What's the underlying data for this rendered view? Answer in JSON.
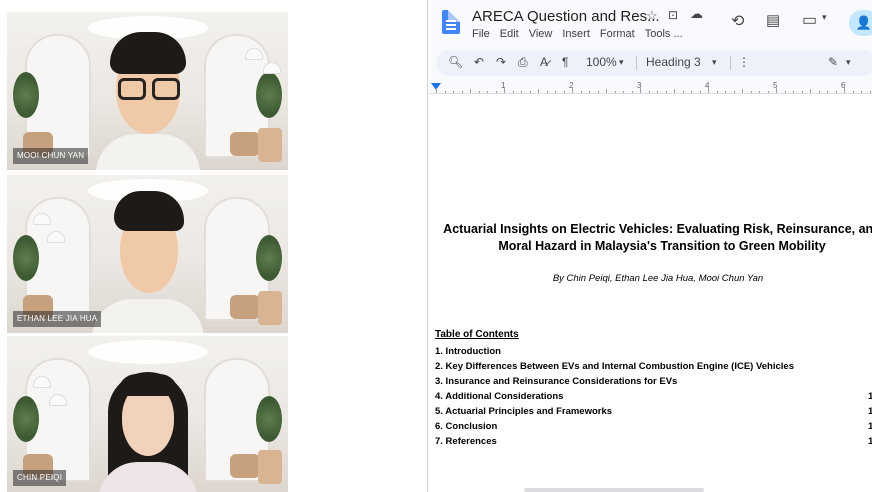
{
  "participants": [
    {
      "name": "MOOI CHUN YAN"
    },
    {
      "name": "ETHAN LEE JIA HUA"
    },
    {
      "name": "CHIN PEIQI"
    }
  ],
  "doc": {
    "title": "ARECA Question and Res...",
    "menu": [
      "File",
      "Edit",
      "View",
      "Insert",
      "Format",
      "Tools ..."
    ],
    "toolbar": {
      "zoom": "100%",
      "style": "Heading 3"
    },
    "ruler_numbers": [
      "1",
      "2",
      "3",
      "4",
      "5",
      "6"
    ],
    "heading_line1": "Actuarial Insights on Electric Vehicles: Evaluating Risk, Reinsurance, and",
    "heading_line2": "Moral Hazard in Malaysia's Transition to Green Mobility",
    "authors": "By Chin Peiqi, Ethan Lee Jia Hua, Mooi Chun Yan",
    "toc_heading": "Table of Contents",
    "toc": [
      {
        "label": "1. Introduction",
        "page": ""
      },
      {
        "label": "2. Key Differences Between EVs and Internal Combustion Engine (ICE) Vehicles",
        "page": ""
      },
      {
        "label": "3. Insurance and Reinsurance Considerations for EVs",
        "page": ""
      },
      {
        "label": "4. Additional Considerations",
        "page": "1"
      },
      {
        "label": "5. Actuarial Principles and Frameworks",
        "page": "1"
      },
      {
        "label": "6. Conclusion",
        "page": "1"
      },
      {
        "label": "7. References",
        "page": "1"
      }
    ]
  },
  "icons": {
    "star": "☆",
    "folder": "⊡",
    "cloud": "☁",
    "history": "⟲",
    "comment": "▤",
    "meet": "▭",
    "share": "👤"
  }
}
